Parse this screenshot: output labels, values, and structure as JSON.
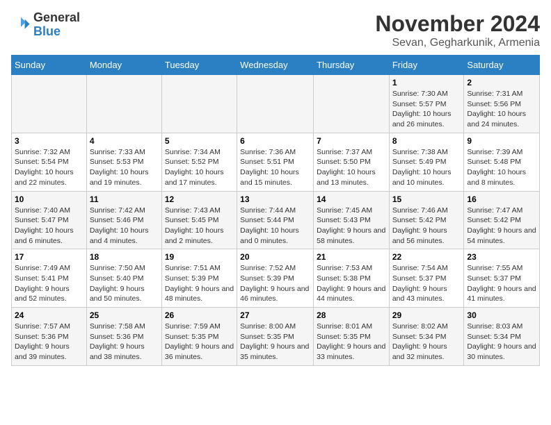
{
  "logo": {
    "general": "General",
    "blue": "Blue"
  },
  "title": "November 2024",
  "location": "Sevan, Gegharkunik, Armenia",
  "days_of_week": [
    "Sunday",
    "Monday",
    "Tuesday",
    "Wednesday",
    "Thursday",
    "Friday",
    "Saturday"
  ],
  "weeks": [
    [
      {
        "day": "",
        "info": ""
      },
      {
        "day": "",
        "info": ""
      },
      {
        "day": "",
        "info": ""
      },
      {
        "day": "",
        "info": ""
      },
      {
        "day": "",
        "info": ""
      },
      {
        "day": "1",
        "info": "Sunrise: 7:30 AM\nSunset: 5:57 PM\nDaylight: 10 hours and 26 minutes."
      },
      {
        "day": "2",
        "info": "Sunrise: 7:31 AM\nSunset: 5:56 PM\nDaylight: 10 hours and 24 minutes."
      }
    ],
    [
      {
        "day": "3",
        "info": "Sunrise: 7:32 AM\nSunset: 5:54 PM\nDaylight: 10 hours and 22 minutes."
      },
      {
        "day": "4",
        "info": "Sunrise: 7:33 AM\nSunset: 5:53 PM\nDaylight: 10 hours and 19 minutes."
      },
      {
        "day": "5",
        "info": "Sunrise: 7:34 AM\nSunset: 5:52 PM\nDaylight: 10 hours and 17 minutes."
      },
      {
        "day": "6",
        "info": "Sunrise: 7:36 AM\nSunset: 5:51 PM\nDaylight: 10 hours and 15 minutes."
      },
      {
        "day": "7",
        "info": "Sunrise: 7:37 AM\nSunset: 5:50 PM\nDaylight: 10 hours and 13 minutes."
      },
      {
        "day": "8",
        "info": "Sunrise: 7:38 AM\nSunset: 5:49 PM\nDaylight: 10 hours and 10 minutes."
      },
      {
        "day": "9",
        "info": "Sunrise: 7:39 AM\nSunset: 5:48 PM\nDaylight: 10 hours and 8 minutes."
      }
    ],
    [
      {
        "day": "10",
        "info": "Sunrise: 7:40 AM\nSunset: 5:47 PM\nDaylight: 10 hours and 6 minutes."
      },
      {
        "day": "11",
        "info": "Sunrise: 7:42 AM\nSunset: 5:46 PM\nDaylight: 10 hours and 4 minutes."
      },
      {
        "day": "12",
        "info": "Sunrise: 7:43 AM\nSunset: 5:45 PM\nDaylight: 10 hours and 2 minutes."
      },
      {
        "day": "13",
        "info": "Sunrise: 7:44 AM\nSunset: 5:44 PM\nDaylight: 10 hours and 0 minutes."
      },
      {
        "day": "14",
        "info": "Sunrise: 7:45 AM\nSunset: 5:43 PM\nDaylight: 9 hours and 58 minutes."
      },
      {
        "day": "15",
        "info": "Sunrise: 7:46 AM\nSunset: 5:42 PM\nDaylight: 9 hours and 56 minutes."
      },
      {
        "day": "16",
        "info": "Sunrise: 7:47 AM\nSunset: 5:42 PM\nDaylight: 9 hours and 54 minutes."
      }
    ],
    [
      {
        "day": "17",
        "info": "Sunrise: 7:49 AM\nSunset: 5:41 PM\nDaylight: 9 hours and 52 minutes."
      },
      {
        "day": "18",
        "info": "Sunrise: 7:50 AM\nSunset: 5:40 PM\nDaylight: 9 hours and 50 minutes."
      },
      {
        "day": "19",
        "info": "Sunrise: 7:51 AM\nSunset: 5:39 PM\nDaylight: 9 hours and 48 minutes."
      },
      {
        "day": "20",
        "info": "Sunrise: 7:52 AM\nSunset: 5:39 PM\nDaylight: 9 hours and 46 minutes."
      },
      {
        "day": "21",
        "info": "Sunrise: 7:53 AM\nSunset: 5:38 PM\nDaylight: 9 hours and 44 minutes."
      },
      {
        "day": "22",
        "info": "Sunrise: 7:54 AM\nSunset: 5:37 PM\nDaylight: 9 hours and 43 minutes."
      },
      {
        "day": "23",
        "info": "Sunrise: 7:55 AM\nSunset: 5:37 PM\nDaylight: 9 hours and 41 minutes."
      }
    ],
    [
      {
        "day": "24",
        "info": "Sunrise: 7:57 AM\nSunset: 5:36 PM\nDaylight: 9 hours and 39 minutes."
      },
      {
        "day": "25",
        "info": "Sunrise: 7:58 AM\nSunset: 5:36 PM\nDaylight: 9 hours and 38 minutes."
      },
      {
        "day": "26",
        "info": "Sunrise: 7:59 AM\nSunset: 5:35 PM\nDaylight: 9 hours and 36 minutes."
      },
      {
        "day": "27",
        "info": "Sunrise: 8:00 AM\nSunset: 5:35 PM\nDaylight: 9 hours and 35 minutes."
      },
      {
        "day": "28",
        "info": "Sunrise: 8:01 AM\nSunset: 5:35 PM\nDaylight: 9 hours and 33 minutes."
      },
      {
        "day": "29",
        "info": "Sunrise: 8:02 AM\nSunset: 5:34 PM\nDaylight: 9 hours and 32 minutes."
      },
      {
        "day": "30",
        "info": "Sunrise: 8:03 AM\nSunset: 5:34 PM\nDaylight: 9 hours and 30 minutes."
      }
    ]
  ]
}
